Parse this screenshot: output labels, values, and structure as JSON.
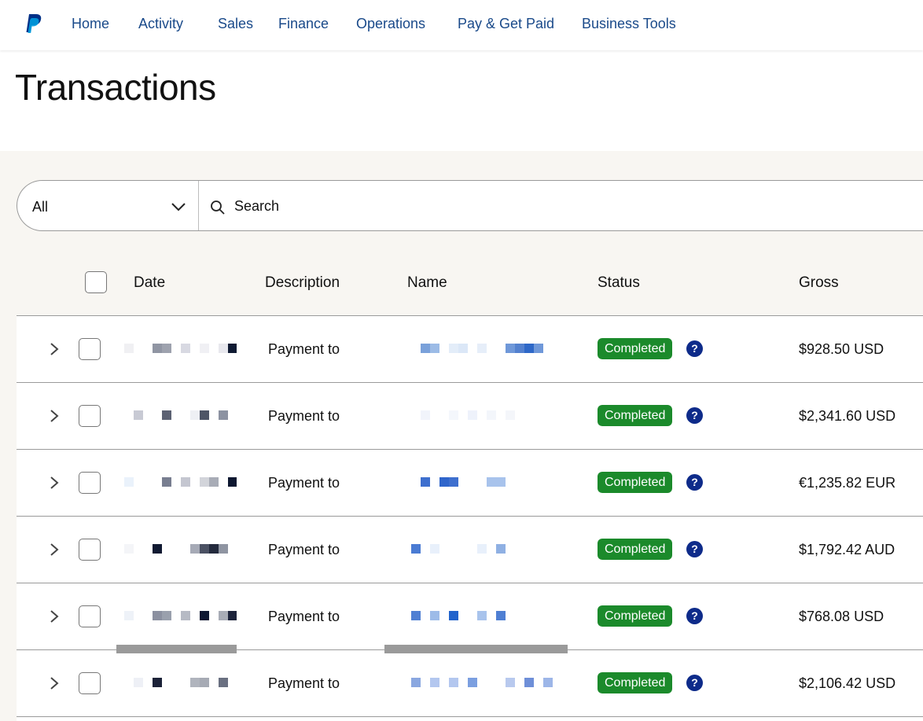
{
  "nav": {
    "logo": "paypal-logo",
    "items": [
      "Home",
      "Activity",
      "Sales",
      "Finance",
      "Operations",
      "Pay & Get Paid",
      "Business Tools"
    ]
  },
  "page": {
    "title": "Transactions"
  },
  "filter": {
    "selected": "All",
    "search_placeholder": "Search"
  },
  "table": {
    "columns": [
      "Date",
      "Description",
      "Name",
      "Status",
      "Gross"
    ],
    "rows": [
      {
        "description": "Payment to",
        "status": "Completed",
        "gross": "$928.50 USD"
      },
      {
        "description": "Payment to",
        "status": "Completed",
        "gross": "$2,341.60 USD"
      },
      {
        "description": "Payment to",
        "status": "Completed",
        "gross": "€1,235.82 EUR"
      },
      {
        "description": "Payment to",
        "status": "Completed",
        "gross": "$1,792.42 AUD"
      },
      {
        "description": "Payment to",
        "status": "Completed",
        "gross": "$768.08 USD"
      },
      {
        "description": "Payment to",
        "status": "Completed",
        "gross": "$2,106.42 USD"
      }
    ],
    "help_glyph": "?"
  },
  "colors": {
    "nav_link": "#1a4a8a",
    "status_completed": "#1b8a2b",
    "help_badge": "#0e2b8a",
    "panel_bg": "#f8f6f2",
    "paypal_dark": "#003087",
    "paypal_light": "#009cde"
  }
}
